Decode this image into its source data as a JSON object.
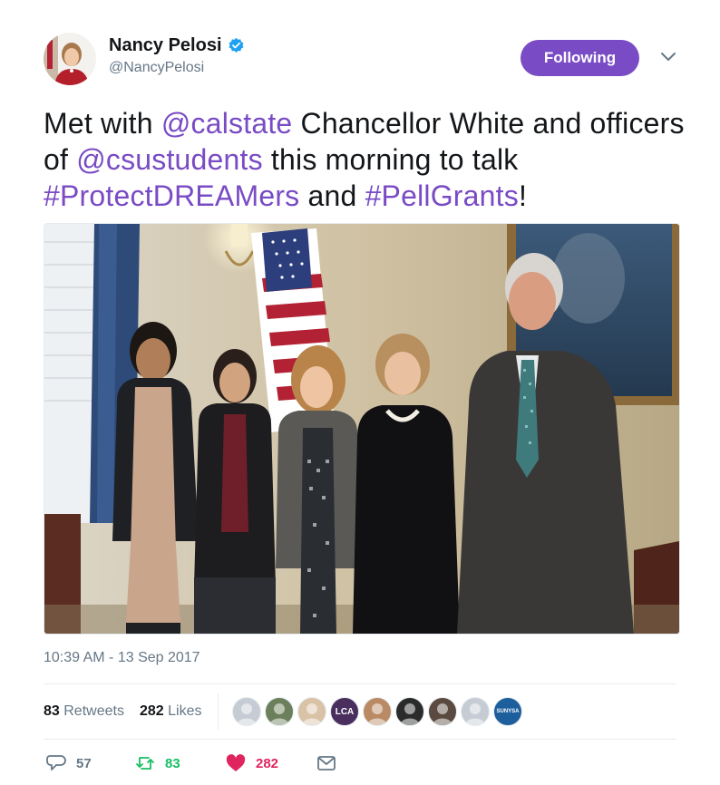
{
  "author": {
    "name": "Nancy Pelosi",
    "handle": "@NancyPelosi",
    "verified": true
  },
  "follow_button": {
    "label": "Following"
  },
  "tweet": {
    "text_parts": [
      {
        "text": "Met with ",
        "link": false
      },
      {
        "text": "@calstate",
        "link": true
      },
      {
        "text": " Chancellor White and officers of ",
        "link": false
      },
      {
        "text": "@csustudents",
        "link": true
      },
      {
        "text": " this morning to talk ",
        "link": false
      },
      {
        "text": "#ProtectDREAMers",
        "link": true
      },
      {
        "text": " and ",
        "link": false
      },
      {
        "text": "#PellGrants",
        "link": true
      },
      {
        "text": "!",
        "link": false
      }
    ]
  },
  "timestamp": "10:39 AM - 13 Sep 2017",
  "stats": {
    "retweets_count": "83",
    "retweets_label": "Retweets",
    "likes_count": "282",
    "likes_label": "Likes"
  },
  "likers": [
    {
      "label": "",
      "color": "#c5ccd3"
    },
    {
      "label": "",
      "color": "#6b7f5a"
    },
    {
      "label": "",
      "color": "#d9c2a6"
    },
    {
      "label": "LCA",
      "color": "#4a2f5e"
    },
    {
      "label": "",
      "color": "#b98a64"
    },
    {
      "label": "",
      "color": "#2b2b2b"
    },
    {
      "label": "",
      "color": "#5a4a3f"
    },
    {
      "label": "",
      "color": "#c5ccd3"
    },
    {
      "label": "SUNYSA",
      "color": "#1d5f9c"
    }
  ],
  "actions": {
    "replies": "57",
    "retweets": "83",
    "likes": "282"
  },
  "colors": {
    "accent": "#794bc4",
    "retweet_green": "#17bf63",
    "like_red": "#e0245e",
    "muted": "#657786"
  }
}
